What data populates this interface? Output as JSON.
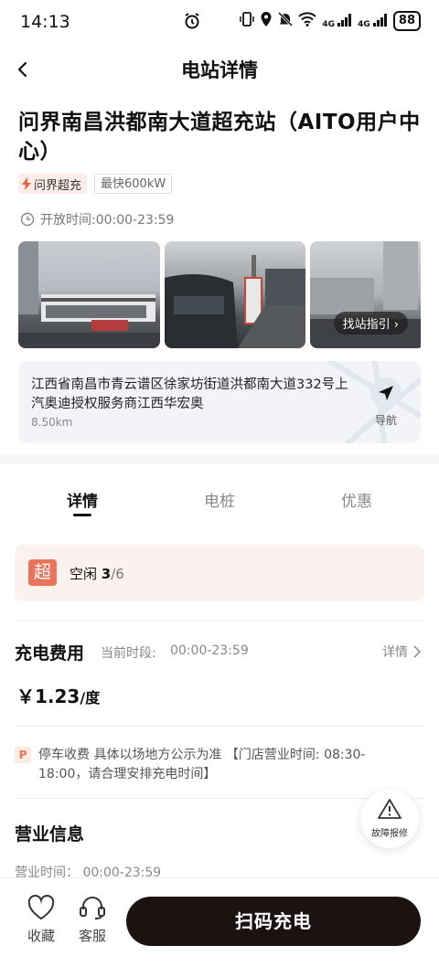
{
  "status_bar": {
    "time": "14:13",
    "network_1": "4G",
    "network_2": "4G",
    "battery": "88"
  },
  "nav": {
    "title": "电站详情"
  },
  "station": {
    "name": "问界南昌洪都南大道超充站（AITO用户中心）",
    "tag_super": "问界超充",
    "tag_power": "最快600kW",
    "hours": "开放时间:00:00-23:59"
  },
  "photos": {
    "find_guide": "找站指引"
  },
  "address": {
    "text": "江西省南昌市青云谱区徐家坊街道洪都南大道332号上汽奥迪授权服务商江西华宏奥",
    "distance": "8.50km",
    "nav_label": "导航"
  },
  "tabs": [
    "详情",
    "电桩",
    "优惠"
  ],
  "idle": {
    "badge": "超",
    "label": "空闲",
    "free": "3",
    "total": "/6"
  },
  "fee": {
    "title": "充电费用",
    "period_label": "当前时段:",
    "period": "00:00-23:59",
    "detail": "详情",
    "price": "￥1.23",
    "unit": "/度"
  },
  "parking": {
    "badge": "P",
    "text": "停车收费 具体以场地方公示为准 【门店营业时间: 08:30-18:00，请合理安排充电时间】"
  },
  "fault": {
    "label": "故障报修"
  },
  "business": {
    "title": "营业信息",
    "hours": "营业时间：  00:00-23:59"
  },
  "bottom": {
    "favorite": "收藏",
    "service": "客服",
    "scan": "扫码充电"
  }
}
